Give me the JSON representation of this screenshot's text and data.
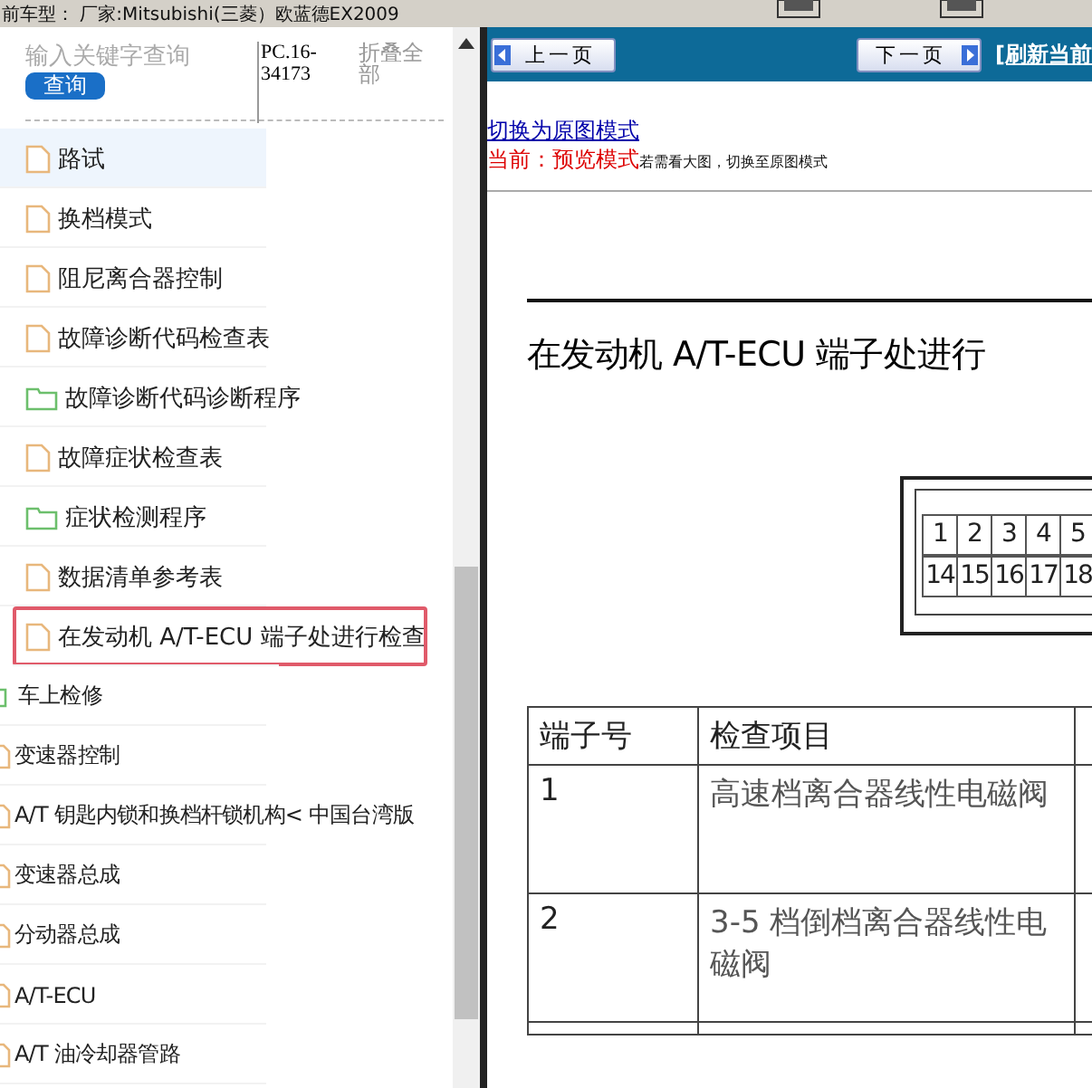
{
  "top_bar": {
    "vehicle": "前车型：  厂家:Mitsubishi(三菱）欧蓝德EX2009"
  },
  "sidebar": {
    "search": {
      "placeholder": "输入关键字查询",
      "button": "查询",
      "code": "PC.16-34173",
      "collapse": "折叠全部"
    },
    "open_branch": {
      "children": [
        {
          "kind": "file",
          "label": "路试",
          "highlighted": true,
          "selected": false
        },
        {
          "kind": "file",
          "label": "换档模式",
          "highlighted": false,
          "selected": false
        },
        {
          "kind": "file",
          "label": "阻尼离合器控制",
          "highlighted": false,
          "selected": false
        },
        {
          "kind": "file",
          "label": "故障诊断代码检查表",
          "highlighted": false,
          "selected": false
        },
        {
          "kind": "folder",
          "label": "故障诊断代码诊断程序",
          "highlighted": false,
          "selected": false
        },
        {
          "kind": "file",
          "label": "故障症状检查表",
          "highlighted": false,
          "selected": false
        },
        {
          "kind": "folder",
          "label": "症状检测程序",
          "highlighted": false,
          "selected": false
        },
        {
          "kind": "file",
          "label": "数据清单参考表",
          "highlighted": false,
          "selected": false
        },
        {
          "kind": "file",
          "label": "在发动机 A/T-ECU 端子处进行检查",
          "highlighted": false,
          "selected": true
        }
      ]
    },
    "items": [
      {
        "kind": "folder",
        "label": "车上检修"
      },
      {
        "kind": "file",
        "label": "变速器控制"
      },
      {
        "kind": "file",
        "label": "A/T 钥匙内锁和换档杆锁机构< 中国台湾版"
      },
      {
        "kind": "file",
        "label": "变速器总成"
      },
      {
        "kind": "file",
        "label": "分动器总成"
      },
      {
        "kind": "file",
        "label": "A/T-ECU"
      },
      {
        "kind": "file",
        "label": "A/T 油冷却器管路"
      }
    ]
  },
  "viewer": {
    "prev": "上一页",
    "next": "下一页",
    "refresh": "[刷新当前",
    "switch_link": "切换为原图模式",
    "mode_label": "当前：预览模式",
    "mode_hint": "若需看大图，切换至原图模式",
    "heading": "在发动机 A/T-ECU 端子处进行",
    "connector_pins": [
      [
        "1",
        "2",
        "3",
        "4",
        "5"
      ],
      [
        "14",
        "15",
        "16",
        "17",
        "18"
      ]
    ],
    "table": {
      "columns": [
        "端子号",
        "检查项目"
      ],
      "rows": [
        [
          "1",
          "高速档离合器线性电磁阀"
        ],
        [
          "2",
          "3-5 档倒档离合器线性电磁阀"
        ]
      ]
    }
  }
}
